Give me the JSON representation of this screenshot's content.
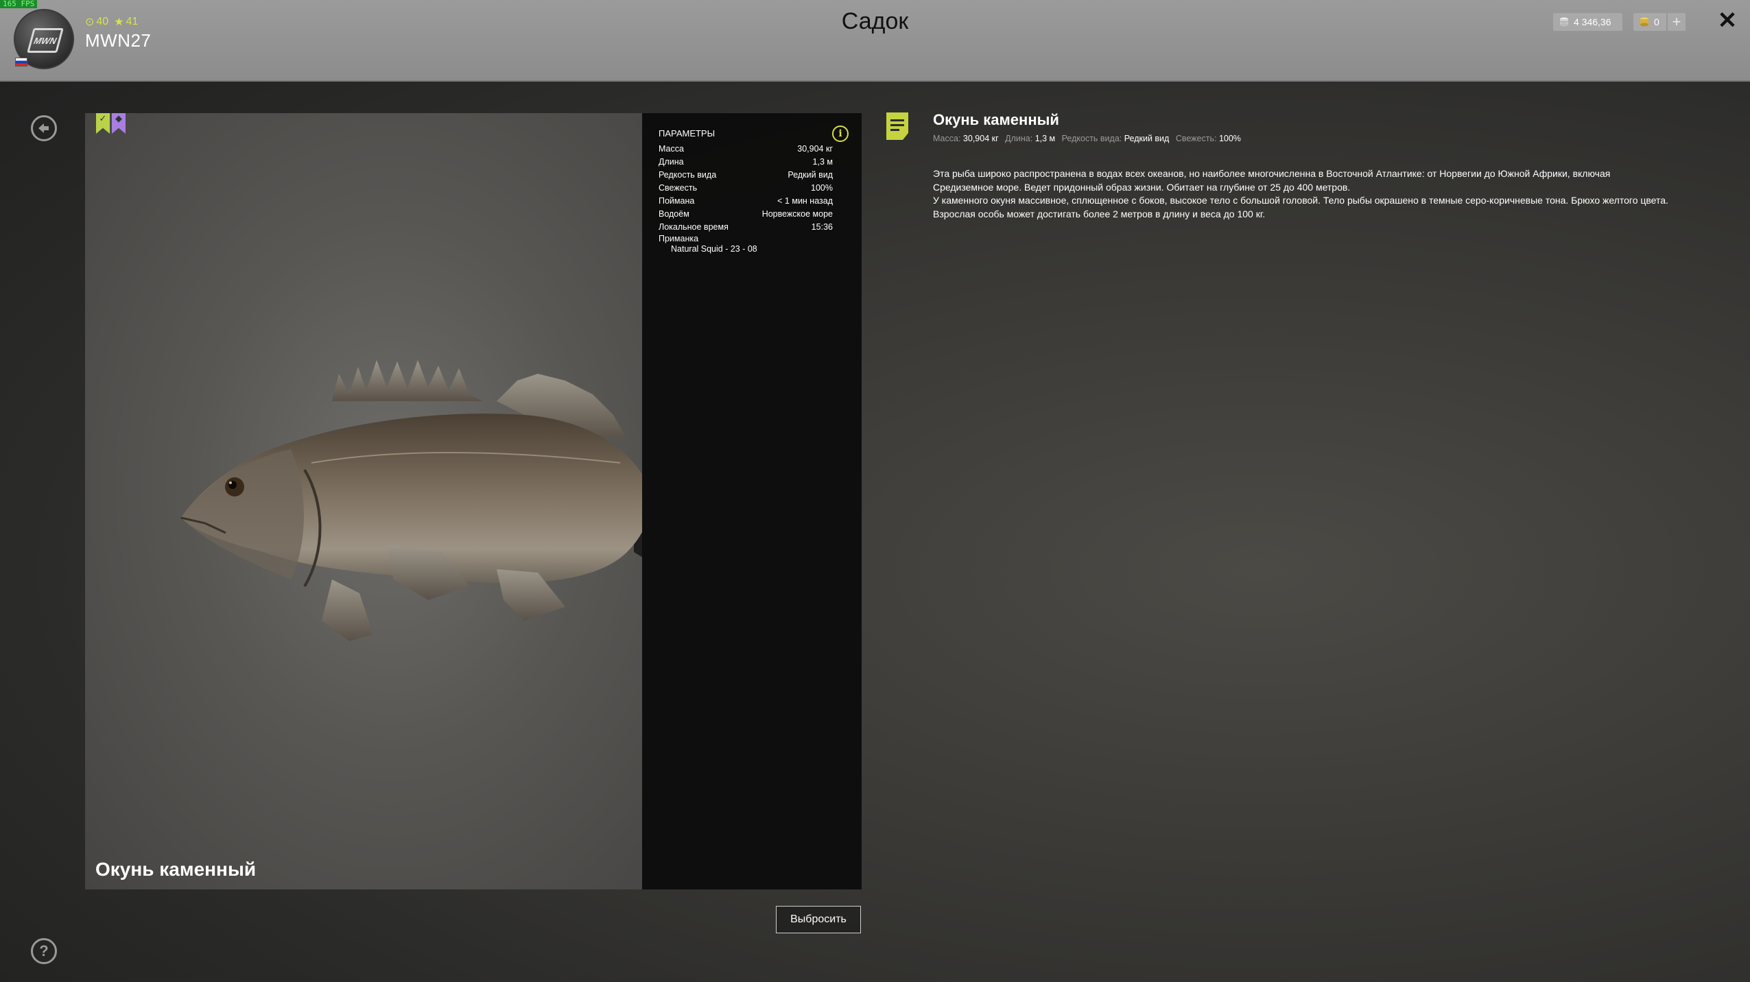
{
  "fps": "165 FPS",
  "profile": {
    "username": "MWN27",
    "avatar_text": "MWN",
    "level": "40",
    "rank": "41"
  },
  "page_title": "Садок",
  "currency": {
    "credits": "4 346,36",
    "gold": "0",
    "add": "+"
  },
  "close_label": "✕",
  "fish": {
    "caption": "Окунь каменный",
    "params_header": "ПАРАМЕТРЫ",
    "params": [
      {
        "label": "Масса",
        "value": "30,904 кг"
      },
      {
        "label": "Длина",
        "value": "1,3 м"
      },
      {
        "label": "Редкость вида",
        "value": "Редкий вид"
      },
      {
        "label": "Свежесть",
        "value": "100%"
      },
      {
        "label": "Поймана",
        "value": "< 1 мин назад"
      },
      {
        "label": "Водоём",
        "value": "Норвежское море"
      },
      {
        "label": "Локальное время",
        "value": "15:36"
      }
    ],
    "bait_label": "Приманка",
    "bait_value": "Natural Squid - 23 - 08",
    "throw_button": "Выбросить"
  },
  "description": {
    "title": "Окунь каменный",
    "meta": [
      {
        "label": "Масса:",
        "value": "30,904 кг"
      },
      {
        "label": "Длина:",
        "value": "1,3 м"
      },
      {
        "label": "Редкость вида:",
        "value": "Редкий вид"
      },
      {
        "label": "Свежесть:",
        "value": "100%"
      }
    ],
    "lines": [
      "Эта рыба широко распространена в водах всех океанов, но наиболее многочисленна в Восточной Атлантике: от Норвегии до Южной Африки, включая",
      "Средиземное море. Ведет придонный образ жизни. Обитает на глубине от 25 до 400 метров.",
      "У каменного окуня массивное, сплющенное с боков, высокое тело с большой головой. Тело рыбы окрашено в темные серо-коричневые тона. Брюхо желтого цвета.",
      "Взрослая особь может достигать более 2 метров в длину и веса до 100 кг."
    ]
  },
  "colors": {
    "accent": "#c4d33f",
    "bookmark_green": "#b9d24a",
    "bookmark_purple": "#a77fe0",
    "topbar": "#949494"
  },
  "icons": [
    "back-arrow-icon",
    "help-icon",
    "info-icon",
    "note-icon",
    "coins-icon",
    "gold-icon",
    "close-icon",
    "bookmark-check-icon",
    "bookmark-pin-icon"
  ]
}
